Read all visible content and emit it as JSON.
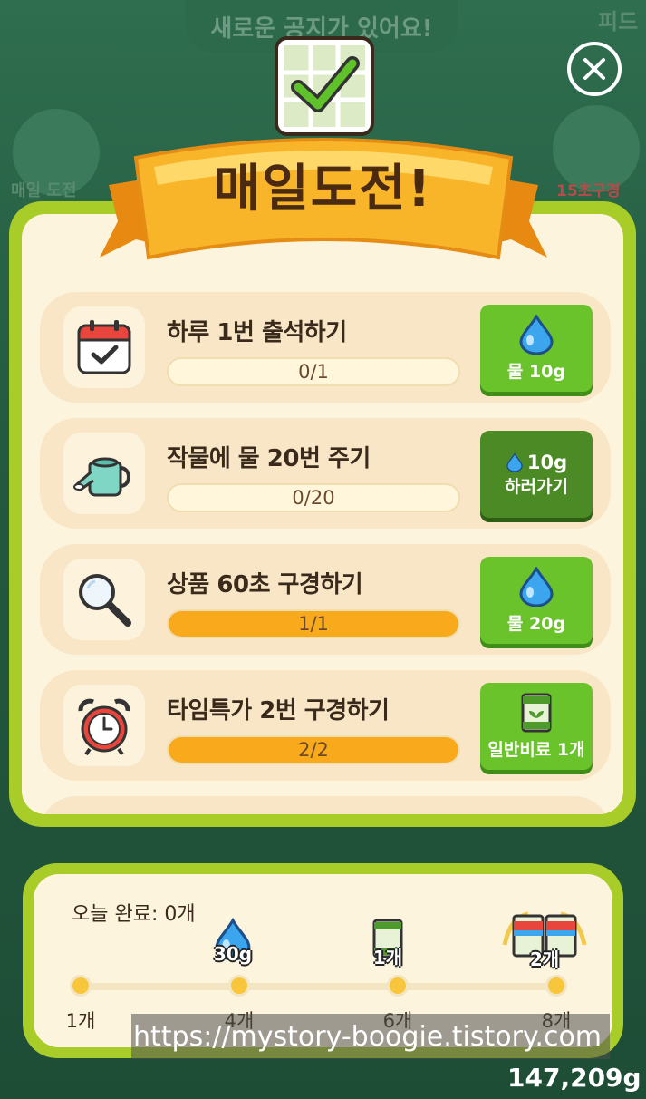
{
  "background": {
    "notice": "새로운 공지가 있어요!",
    "left_label": "매일 도전",
    "right_label": "15초구경",
    "feed_label": "피드",
    "balance": "147,209g"
  },
  "header": {
    "title": "매일도전!"
  },
  "tasks": [
    {
      "title": "하루 1번 출석하기",
      "progress_text": "0/1",
      "progress": 0,
      "reward": "물 10g",
      "icon": "calendar-icon",
      "reward_icon": "water-drop-icon"
    },
    {
      "title": "작물에 물 20번 주기",
      "progress_text": "0/20",
      "progress": 0,
      "reward_amount": "10g",
      "reward_action": "하러가기",
      "icon": "watering-can-icon",
      "reward_icon": "water-drop-icon"
    },
    {
      "title": "상품 60초 구경하기",
      "progress_text": "1/1",
      "progress": 1,
      "reward": "물 20g",
      "icon": "magnifier-icon",
      "reward_icon": "water-drop-icon"
    },
    {
      "title": "타임특가 2번 구경하기",
      "progress_text": "2/2",
      "progress": 1,
      "reward": "일반비료 1개",
      "icon": "alarm-clock-icon",
      "reward_icon": "fertilizer-bag-icon"
    }
  ],
  "summary": {
    "completed": "오늘 완료: 0개",
    "milestones": [
      {
        "label": "1개"
      },
      {
        "label": "4개",
        "reward": "30g",
        "reward_icon": "water-drop-icon"
      },
      {
        "label": "6개",
        "reward": "1개",
        "reward_icon": "fertilizer-bag-icon"
      },
      {
        "label": "8개",
        "reward": "2개",
        "reward_icon": "fertilizer-bags-icon"
      }
    ]
  },
  "watermark": "https://mystory-boogie.tistory.com",
  "colors": {
    "panel_green": "#a8cc28",
    "button_green": "#6ac32a",
    "progress_orange": "#f9a91c",
    "cream": "#fdf4dd"
  }
}
